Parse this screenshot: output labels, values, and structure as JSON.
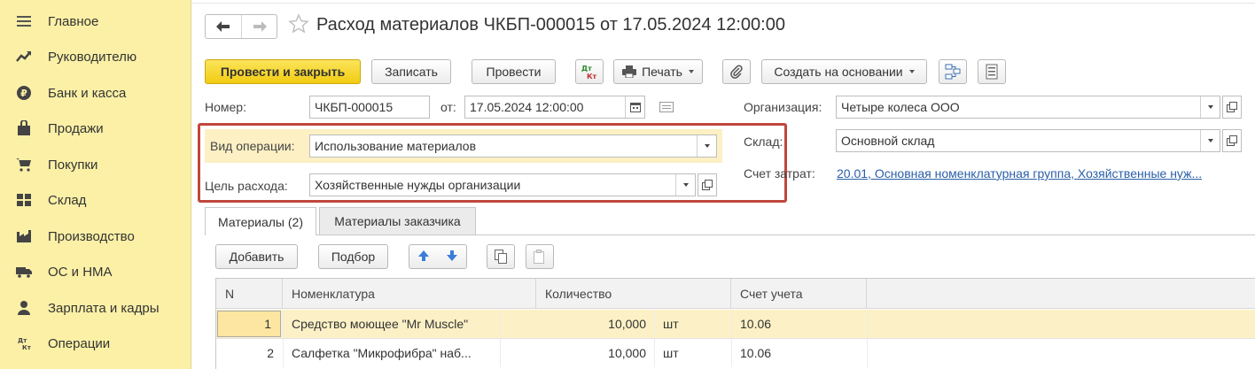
{
  "sidebar": {
    "items": [
      {
        "label": "Главное",
        "icon": "menu-icon"
      },
      {
        "label": "Руководителю",
        "icon": "trend-icon"
      },
      {
        "label": "Банк и касса",
        "icon": "ruble-icon"
      },
      {
        "label": "Продажи",
        "icon": "bag-icon"
      },
      {
        "label": "Покупки",
        "icon": "cart-icon"
      },
      {
        "label": "Склад",
        "icon": "warehouse-icon"
      },
      {
        "label": "Производство",
        "icon": "factory-icon"
      },
      {
        "label": "ОС и НМА",
        "icon": "truck-icon"
      },
      {
        "label": "Зарплата и кадры",
        "icon": "person-icon"
      },
      {
        "label": "Операции",
        "icon": "dt-kt-icon"
      }
    ]
  },
  "header": {
    "title": "Расход материалов ЧКБП-000015 от 17.05.2024 12:00:00"
  },
  "toolbar": {
    "post_close": "Провести и закрыть",
    "save": "Записать",
    "post": "Провести",
    "dtkt_top": "Дт",
    "dtkt_bottom": "Кт",
    "print": "Печать",
    "create_based": "Создать на основании"
  },
  "form": {
    "number_label": "Номер:",
    "number_value": "ЧКБП-000015",
    "date_label": "от:",
    "date_value": "17.05.2024 12:00:00",
    "operation_label": "Вид операции:",
    "operation_value": "Использование материалов",
    "purpose_label": "Цель расхода:",
    "purpose_value": "Хозяйственные нужды организации",
    "org_label": "Организация:",
    "org_value": "Четыре колеса ООО",
    "warehouse_label": "Склад:",
    "warehouse_value": "Основной склад",
    "cost_label": "Счет затрат:",
    "cost_value": "20.01, Основная номенклатурная группа, Хозяйственные нуж..."
  },
  "tabs": [
    {
      "label": "Материалы (2)"
    },
    {
      "label": "Материалы заказчика"
    }
  ],
  "table_toolbar": {
    "add": "Добавить",
    "select": "Подбор"
  },
  "table": {
    "columns": [
      "N",
      "Номенклатура",
      "Количество",
      "Счет учета"
    ],
    "rows": [
      {
        "n": "1",
        "name": "Средство моющее \"Mr Muscle\"",
        "qty": "10,000",
        "unit": "шт",
        "account": "10.06"
      },
      {
        "n": "2",
        "name": "Салфетка \"Микрофибра\" наб...",
        "qty": "10,000",
        "unit": "шт",
        "account": "10.06"
      }
    ]
  },
  "colors": {
    "sidebar_bg": "#fbf0a6",
    "primary_button": "#f5d327",
    "highlight_row": "#fcf0c4",
    "annotation_box": "#c0463d",
    "link": "#2b5fa8"
  }
}
